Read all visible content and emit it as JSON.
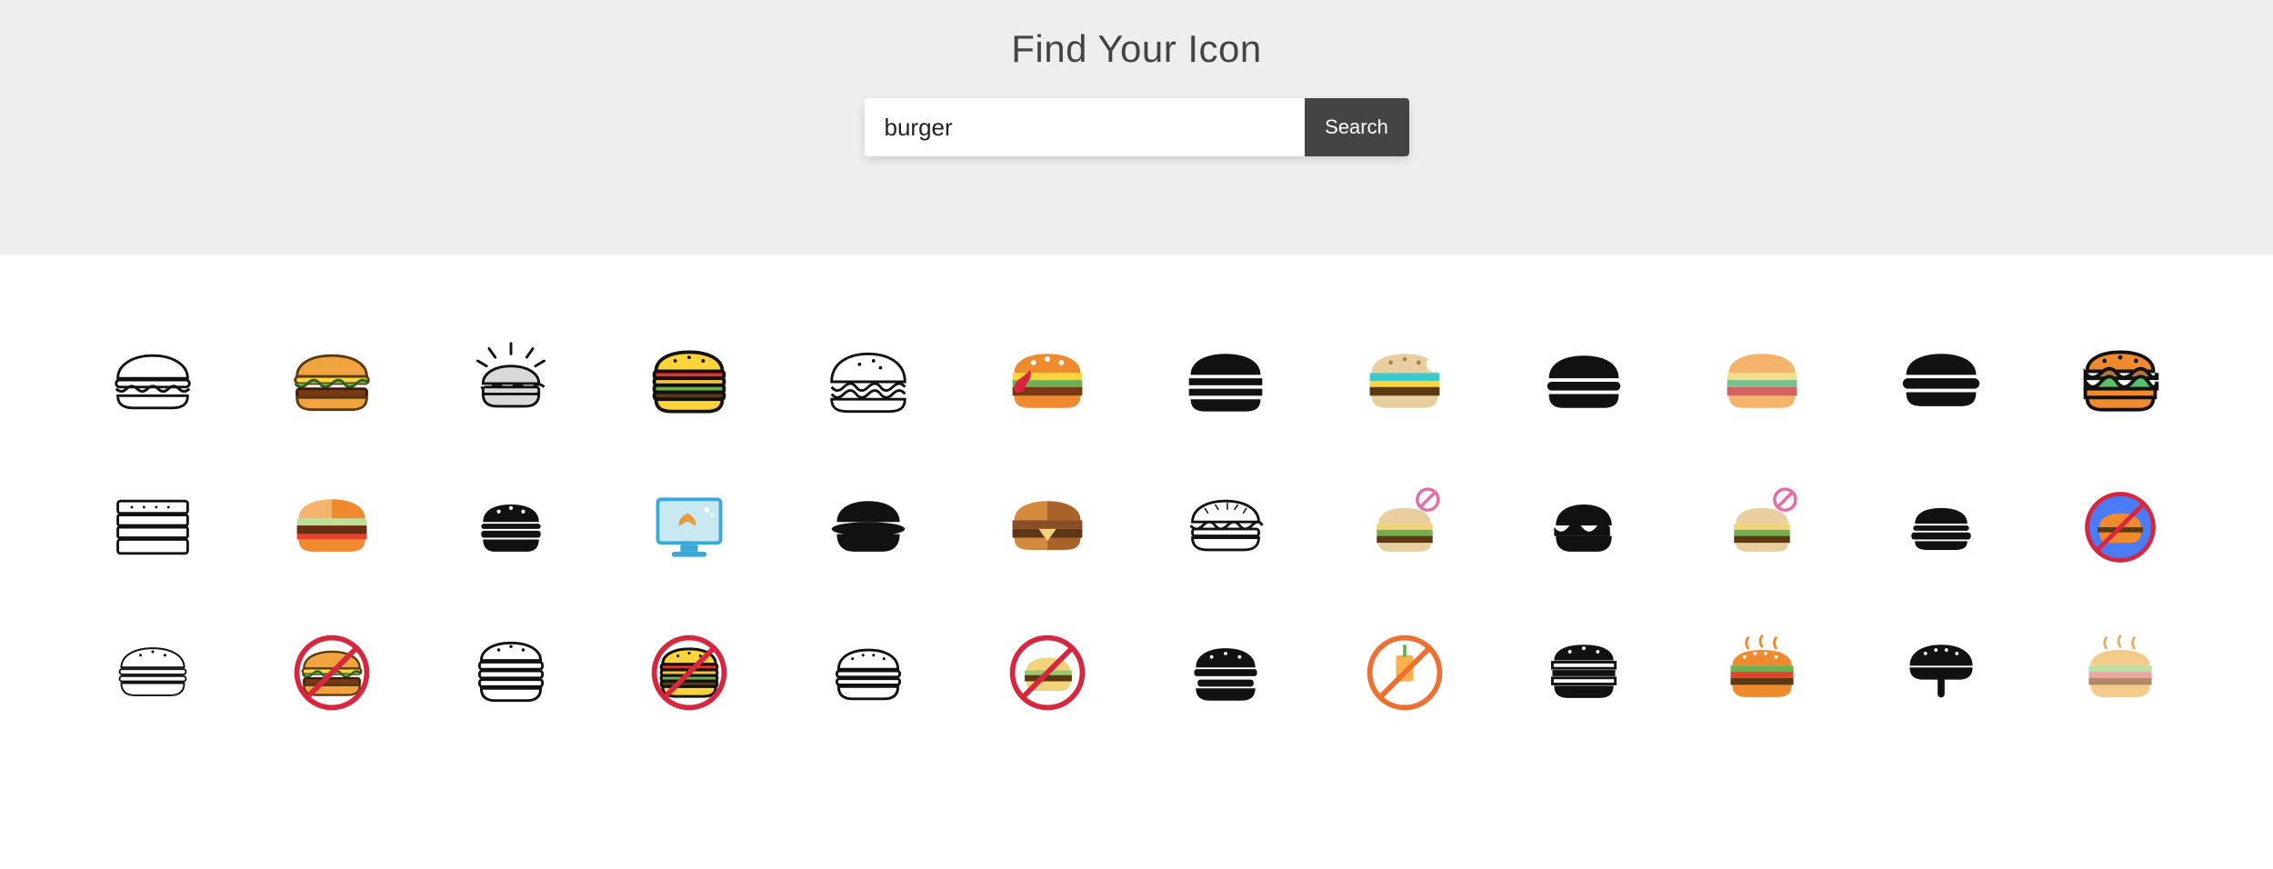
{
  "header": {
    "title": "Find Your Icon",
    "search_value": "burger",
    "search_placeholder": "",
    "search_button_label": "Search"
  },
  "icons": [
    {
      "name": "burger-outline-simple",
      "style": "outline"
    },
    {
      "name": "burger-color-classic",
      "style": "color"
    },
    {
      "name": "burger-shining",
      "style": "line"
    },
    {
      "name": "burger-tall-color",
      "style": "color"
    },
    {
      "name": "burger-dome-line",
      "style": "line"
    },
    {
      "name": "burger-flat-ketchup",
      "style": "flat"
    },
    {
      "name": "burger-solid-black",
      "style": "solid"
    },
    {
      "name": "burger-teal-bite",
      "style": "flat"
    },
    {
      "name": "burger-solid-round",
      "style": "solid"
    },
    {
      "name": "burger-pastel-layers",
      "style": "flat"
    },
    {
      "name": "burger-solid-stripes",
      "style": "solid"
    },
    {
      "name": "burger-cartoon-lettuce",
      "style": "color"
    },
    {
      "name": "burger-stack-line",
      "style": "line"
    },
    {
      "name": "burger-split-flat",
      "style": "flat"
    },
    {
      "name": "burger-mini-solid",
      "style": "solid"
    },
    {
      "name": "burger-monitor-pretzel",
      "style": "flat"
    },
    {
      "name": "burger-lozenge-solid",
      "style": "solid"
    },
    {
      "name": "burger-two-tone-flat",
      "style": "flat"
    },
    {
      "name": "burger-detailed-line",
      "style": "line"
    },
    {
      "name": "burger-no-flat-corner",
      "style": "flat",
      "badge": "no"
    },
    {
      "name": "burger-blob-solid",
      "style": "solid"
    },
    {
      "name": "burger-no-flat-alt",
      "style": "flat",
      "badge": "no"
    },
    {
      "name": "burger-solid-mini-alt",
      "style": "solid"
    },
    {
      "name": "burger-circle-badge",
      "style": "badge"
    },
    {
      "name": "burger-thin-line",
      "style": "line"
    },
    {
      "name": "no-burger-color-1",
      "style": "no"
    },
    {
      "name": "burger-tall-line",
      "style": "line"
    },
    {
      "name": "no-burger-color-2",
      "style": "no"
    },
    {
      "name": "burger-sesame-line",
      "style": "line"
    },
    {
      "name": "no-burger-flat",
      "style": "no"
    },
    {
      "name": "burger-solid-sesame",
      "style": "solid"
    },
    {
      "name": "no-drink-burger",
      "style": "no"
    },
    {
      "name": "burger-tall-bw",
      "style": "solid"
    },
    {
      "name": "burger-hot-color",
      "style": "flat"
    },
    {
      "name": "burger-drip-solid",
      "style": "solid"
    },
    {
      "name": "burger-hot-pastel",
      "style": "flat"
    }
  ]
}
